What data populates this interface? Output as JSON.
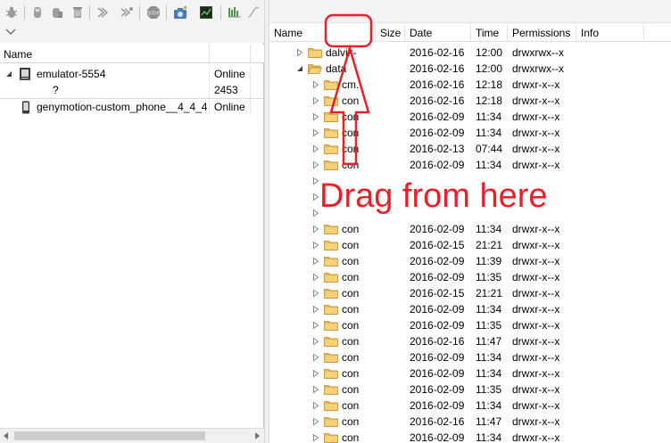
{
  "device_panel": {
    "header": {
      "name": "Name"
    },
    "devices": [
      {
        "name": "emulator-5554",
        "status": "Online",
        "expanded": true,
        "icon": "emulator-device-icon"
      },
      {
        "name": "?",
        "status": "2453",
        "child": true
      },
      {
        "name": "genymotion-custom_phone__4_4_4",
        "status": "Online",
        "icon": "phone-device-icon"
      }
    ]
  },
  "file_explorer": {
    "headers": {
      "name": "Name",
      "size": "Size",
      "date": "Date",
      "time": "Time",
      "permissions": "Permissions",
      "info": "Info"
    },
    "rows": [
      {
        "name": "dalvik-",
        "date": "2016-02-16",
        "time": "12:00",
        "perm": "drwxrwx--x",
        "level": 0,
        "expanded": false
      },
      {
        "name": "data",
        "date": "2016-02-16",
        "time": "12:00",
        "perm": "drwxrwx--x",
        "level": 0,
        "expanded": true
      },
      {
        "name": "cm.",
        "date": "2016-02-16",
        "time": "12:18",
        "perm": "drwxr-x--x",
        "level": 1
      },
      {
        "name": "con",
        "date": "2016-02-16",
        "time": "12:18",
        "perm": "drwxr-x--x",
        "level": 1
      },
      {
        "name": "con",
        "date": "2016-02-09",
        "time": "11:34",
        "perm": "drwxr-x--x",
        "level": 1
      },
      {
        "name": "con",
        "date": "2016-02-09",
        "time": "11:34",
        "perm": "drwxr-x--x",
        "level": 1
      },
      {
        "name": "con",
        "date": "2016-02-13",
        "time": "07:44",
        "perm": "drwxr-x--x",
        "level": 1
      },
      {
        "name": "con",
        "date": "2016-02-09",
        "time": "11:34",
        "perm": "drwxr-x--x",
        "level": 1
      },
      {
        "name": "",
        "date": "",
        "time": "",
        "perm": "",
        "level": 1,
        "hidden": true
      },
      {
        "name": "",
        "date": "",
        "time": "",
        "perm": "",
        "level": 1,
        "hidden": true
      },
      {
        "name": "",
        "date": "",
        "time": "",
        "perm": "",
        "level": 1,
        "hidden": true
      },
      {
        "name": "con",
        "date": "2016-02-09",
        "time": "11:34",
        "perm": "drwxr-x--x",
        "level": 1
      },
      {
        "name": "con",
        "date": "2016-02-15",
        "time": "21:21",
        "perm": "drwxr-x--x",
        "level": 1
      },
      {
        "name": "con",
        "date": "2016-02-09",
        "time": "11:39",
        "perm": "drwxr-x--x",
        "level": 1
      },
      {
        "name": "con",
        "date": "2016-02-09",
        "time": "11:35",
        "perm": "drwxr-x--x",
        "level": 1
      },
      {
        "name": "con",
        "date": "2016-02-15",
        "time": "21:21",
        "perm": "drwxr-x--x",
        "level": 1
      },
      {
        "name": "con",
        "date": "2016-02-09",
        "time": "11:34",
        "perm": "drwxr-x--x",
        "level": 1
      },
      {
        "name": "con",
        "date": "2016-02-09",
        "time": "11:35",
        "perm": "drwxr-x--x",
        "level": 1
      },
      {
        "name": "con",
        "date": "2016-02-16",
        "time": "11:47",
        "perm": "drwxr-x--x",
        "level": 1
      },
      {
        "name": "con",
        "date": "2016-02-09",
        "time": "11:34",
        "perm": "drwxr-x--x",
        "level": 1
      },
      {
        "name": "con",
        "date": "2016-02-09",
        "time": "11:34",
        "perm": "drwxr-x--x",
        "level": 1
      },
      {
        "name": "con",
        "date": "2016-02-09",
        "time": "11:35",
        "perm": "drwxr-x--x",
        "level": 1
      },
      {
        "name": "con",
        "date": "2016-02-09",
        "time": "11:34",
        "perm": "drwxr-x--x",
        "level": 1
      },
      {
        "name": "con",
        "date": "2016-02-16",
        "time": "11:47",
        "perm": "drwxr-x--x",
        "level": 1
      },
      {
        "name": "con",
        "date": "2016-02-09",
        "time": "11:34",
        "perm": "drwxr-x--x",
        "level": 1
      }
    ]
  },
  "annotation": {
    "text": "Drag from here",
    "color": "#e8202a"
  },
  "colors": {
    "folder": "#e8b84a",
    "toolbar_bg": "#f3f3f3",
    "grid_line": "#e2e2e2"
  }
}
